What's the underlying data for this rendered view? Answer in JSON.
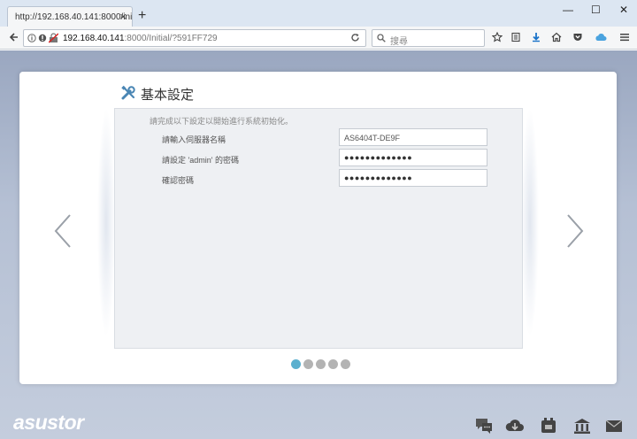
{
  "browser": {
    "tab_title": "http://192.168.40.141:8000/ini",
    "tab_close": "×",
    "new_tab": "+",
    "min": "—",
    "max": "☐",
    "close": "✕",
    "url_host": "192.168.40.141",
    "url_rest": ":8000/Initial/?591FF729",
    "search_placeholder": "搜尋",
    "icons": [
      "back-icon",
      "info-icon",
      "reload-icon",
      "search-icon",
      "star-icon",
      "reading-list-icon",
      "download-icon",
      "home-icon",
      "pocket-icon",
      "cloud-icon",
      "menu-icon"
    ]
  },
  "wizard": {
    "title": "基本設定",
    "intro": "請完成以下設定以開始進行系統初始化。",
    "fields": [
      {
        "label": "請輸入伺服器名稱",
        "value": "AS6404T-DE9F"
      },
      {
        "label": "請設定 'admin' 的密碼",
        "value": "●●●●●●●●●●●●●"
      },
      {
        "label": "確認密碼",
        "value": "●●●●●●●●●●●●●"
      }
    ],
    "step_count": 5,
    "active_step": 1
  },
  "footer": {
    "logo": "asustor",
    "icons": [
      "chat-icon",
      "cloud-download-icon",
      "app-icon",
      "bank-icon",
      "mail-icon"
    ]
  },
  "colors": {
    "accent": "#5bb0cf",
    "page_bg": "#b5c0d4"
  }
}
